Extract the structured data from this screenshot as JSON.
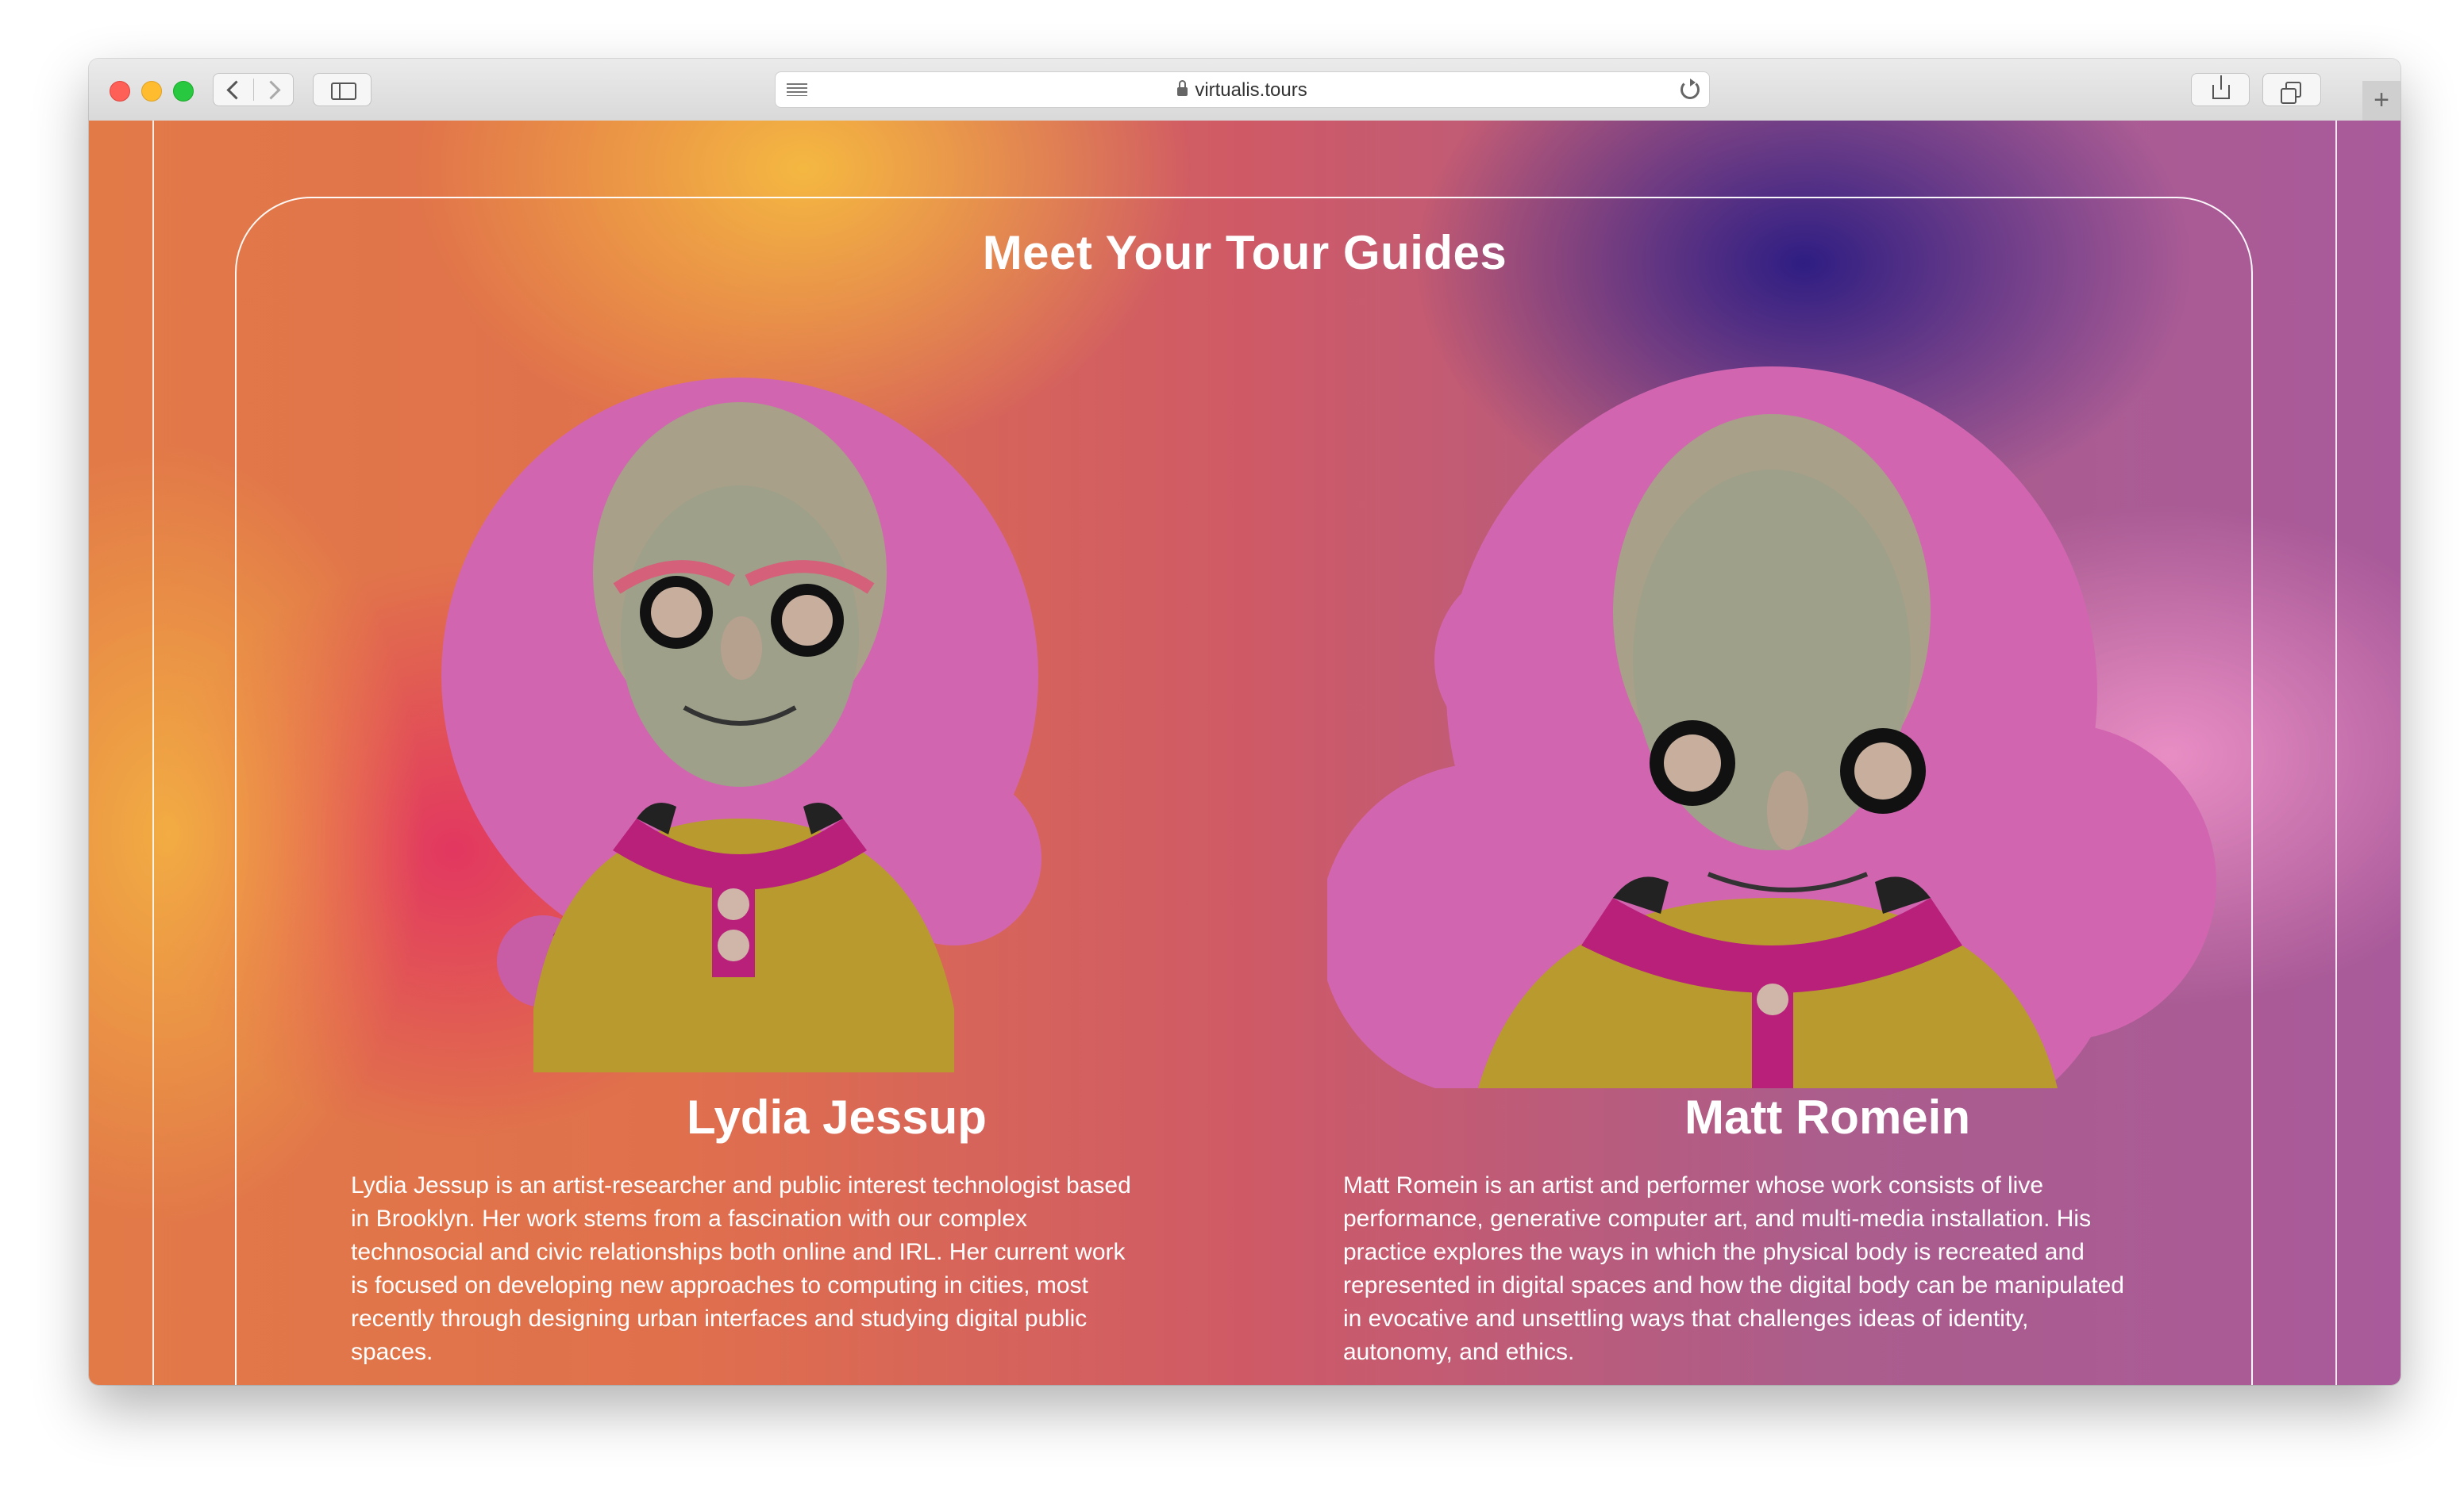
{
  "browser": {
    "url": "virtualis.tours"
  },
  "page": {
    "section_title": "Meet Your Tour Guides",
    "guides": [
      {
        "name": "Lydia Jessup",
        "bio": "Lydia Jessup is an artist-researcher and public interest technologist based in Brooklyn. Her work stems from a fascination with our complex technosocial and civic relationships both online and IRL. Her current work is focused on developing new approaches to computing in cities, most recently through designing urban interfaces and studying digital public spaces."
      },
      {
        "name": "Matt Romein",
        "bio": "Matt Romein is an artist and performer whose work consists of live performance, generative computer art, and multi-media installation. His practice explores the ways in which the physical body is recreated and represented in digital spaces and how the digital body can be manipulated in evocative and unsettling ways that challenges ideas of identity, autonomy, and ethics."
      }
    ]
  },
  "colors": {
    "blob_pink": "#d265b0",
    "shirt_yellow": "#b99a2e",
    "collar_magenta": "#b8207a",
    "skin_grey": "#9ea08a"
  }
}
